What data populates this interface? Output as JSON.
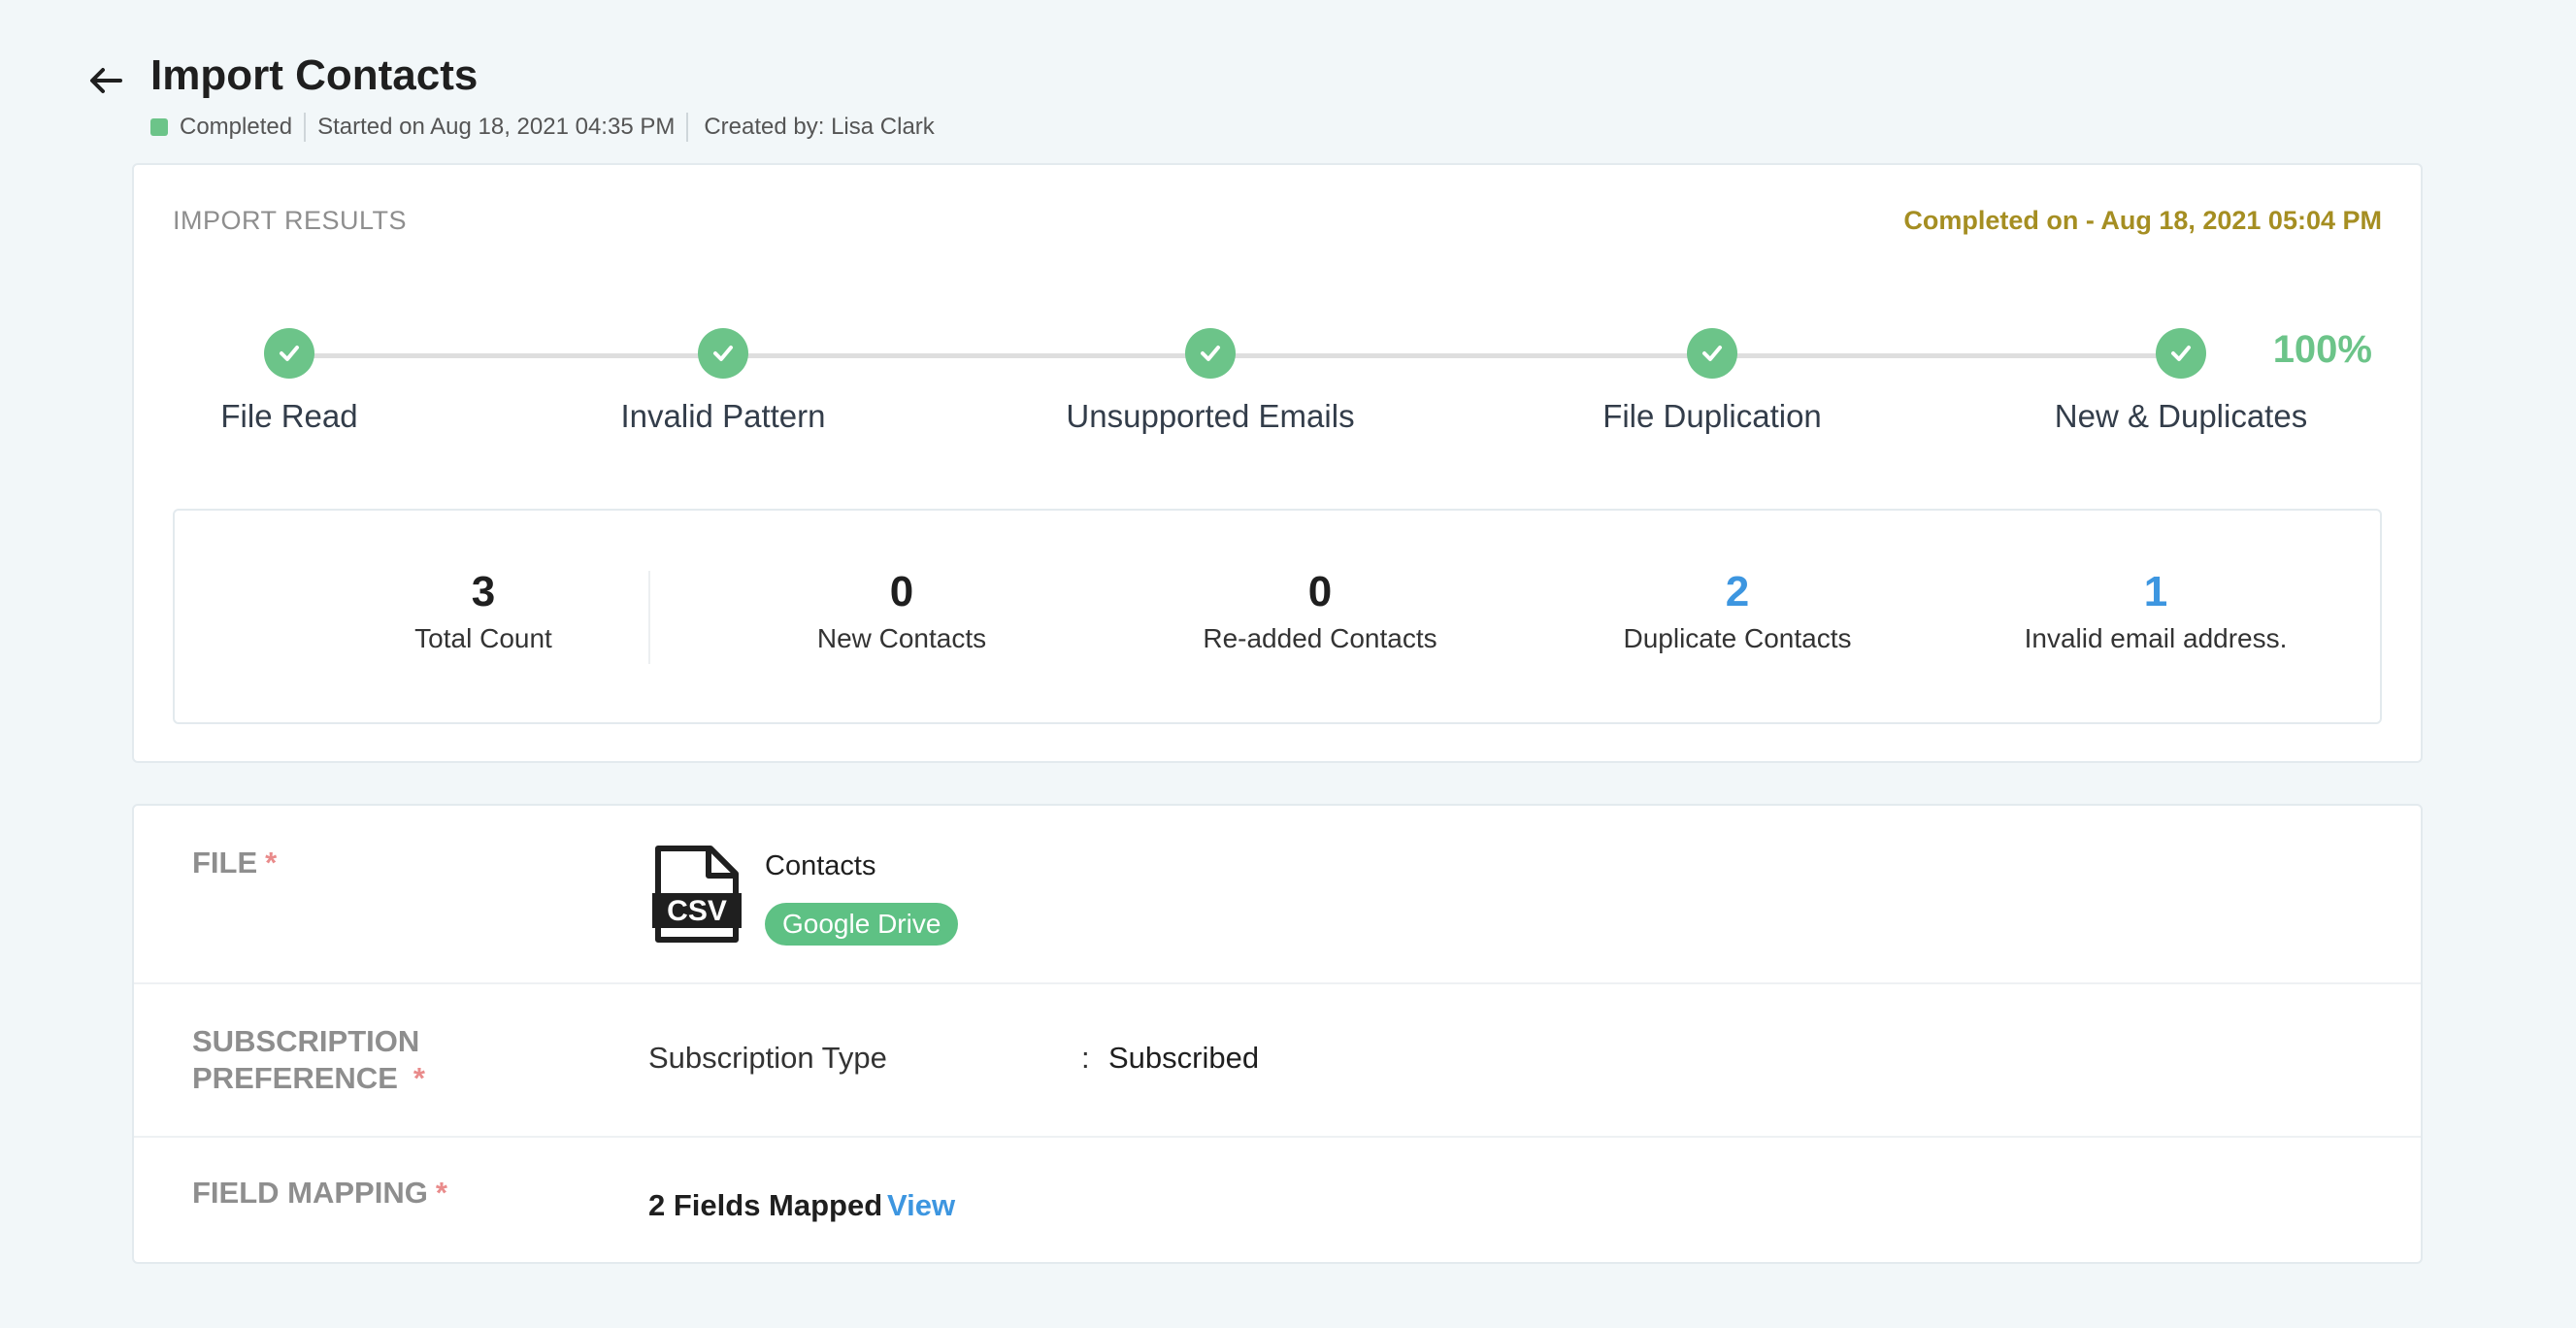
{
  "header": {
    "title": "Import Contacts",
    "status": "Completed",
    "started": "Started on Aug 18, 2021 04:35 PM",
    "created_by": "Created by: Lisa Clark"
  },
  "results": {
    "heading": "IMPORT RESULTS",
    "completed_on": "Completed on - Aug 18, 2021 05:04 PM",
    "progress_percent": "100%",
    "steps": [
      {
        "label": "File Read",
        "done": true
      },
      {
        "label": "Invalid Pattern",
        "done": true
      },
      {
        "label": "Unsupported Emails",
        "done": true
      },
      {
        "label": "File Duplication",
        "done": true
      },
      {
        "label": "New & Duplicates",
        "done": true
      }
    ],
    "stats": [
      {
        "value": "3",
        "label": "Total Count"
      },
      {
        "value": "0",
        "label": "New Contacts"
      },
      {
        "value": "0",
        "label": "Re-added Contacts"
      },
      {
        "value": "2",
        "label": "Duplicate Contacts"
      },
      {
        "value": "1",
        "label": "Invalid email address."
      }
    ]
  },
  "details": {
    "file_label": "FILE",
    "file_name": "Contacts",
    "file_type_icon": "CSV",
    "file_source": "Google Drive",
    "subscription_label_line1": "SUBSCRIPTION",
    "subscription_label_line2": "PREFERENCE",
    "subscription_type_label": "Subscription Type",
    "subscription_value": "Subscribed",
    "field_mapping_label": "FIELD MAPPING",
    "fields_mapped": "2 Fields Mapped",
    "view_link": "View"
  },
  "colors": {
    "success": "#6cc489",
    "accent_gold": "#a58e22",
    "link_blue": "#3d96e0",
    "required": "#e98b8b"
  }
}
